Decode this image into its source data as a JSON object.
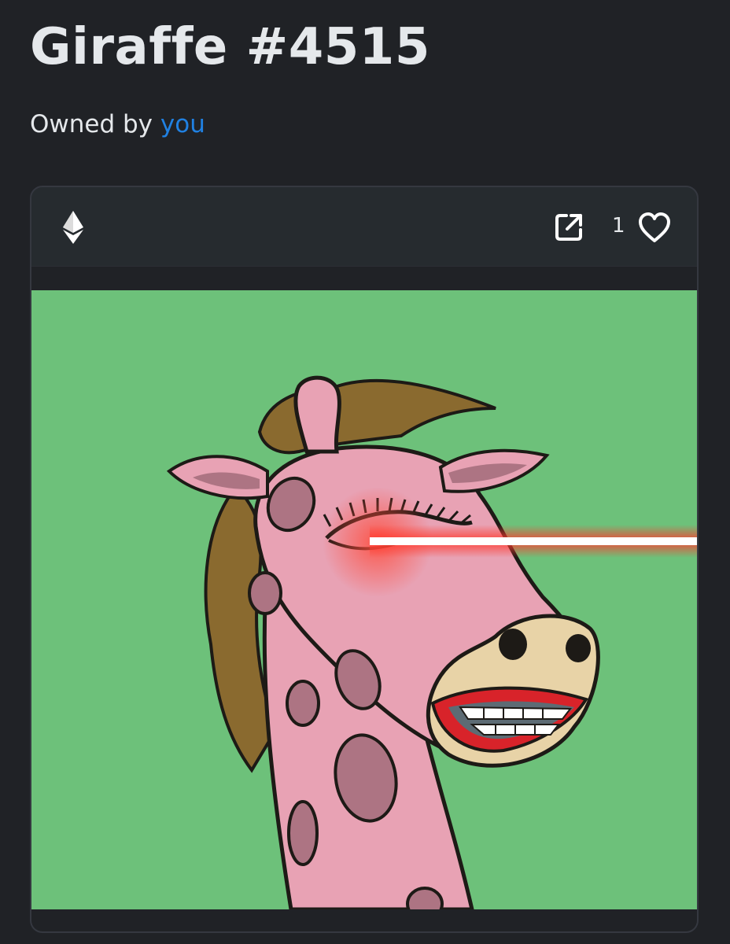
{
  "nft": {
    "title": "Giraffe #4515",
    "owner_prefix": "Owned by ",
    "owner_name": "you",
    "favorites_count": "1"
  },
  "icons": {
    "chain": "ethereum-icon",
    "external_link": "external-link-icon",
    "favorite": "heart-outline-icon"
  },
  "colors": {
    "background": "#202226",
    "link": "#2081e2",
    "art_background": "#6dc17a",
    "giraffe_body": "#e8a2b4",
    "giraffe_spots": "#ad7483",
    "mane": "#8a6a2f",
    "laser": "#ff3b2f"
  }
}
